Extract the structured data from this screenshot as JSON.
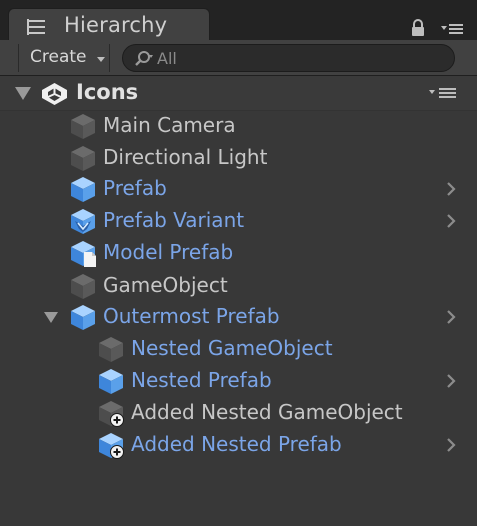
{
  "window": {
    "tab_title": "Hierarchy"
  },
  "toolbar": {
    "create_label": "Create",
    "search_placeholder": "All"
  },
  "scene": {
    "title": "Icons"
  },
  "items": [
    {
      "label": "Main Camera",
      "style": "normal",
      "icon": "gameobject-icon"
    },
    {
      "label": "Directional Light",
      "style": "normal",
      "icon": "gameobject-icon"
    },
    {
      "label": "Prefab",
      "style": "prefab",
      "icon": "prefab-icon"
    },
    {
      "label": "Prefab Variant",
      "style": "prefab",
      "icon": "prefab-variant-icon"
    },
    {
      "label": "Model Prefab",
      "style": "prefab",
      "icon": "model-prefab-icon"
    },
    {
      "label": "GameObject",
      "style": "normal",
      "icon": "gameobject-icon"
    },
    {
      "label": "Outermost Prefab",
      "style": "prefab",
      "icon": "prefab-icon"
    },
    {
      "label": "Nested GameObject",
      "style": "prefab",
      "icon": "gameobject-icon"
    },
    {
      "label": "Nested Prefab",
      "style": "prefab",
      "icon": "prefab-icon"
    },
    {
      "label": "Added Nested GameObject",
      "style": "normal",
      "icon": "added-gameobject-icon"
    },
    {
      "label": "Added Nested Prefab",
      "style": "prefab",
      "icon": "added-prefab-icon"
    }
  ],
  "colors": {
    "panel_background": "#383838",
    "tab_background": "#414141",
    "prefab_text": "#7ba5e8",
    "normal_text": "#c7c7c7",
    "prefab_cube_blue": "#4a8fde"
  }
}
